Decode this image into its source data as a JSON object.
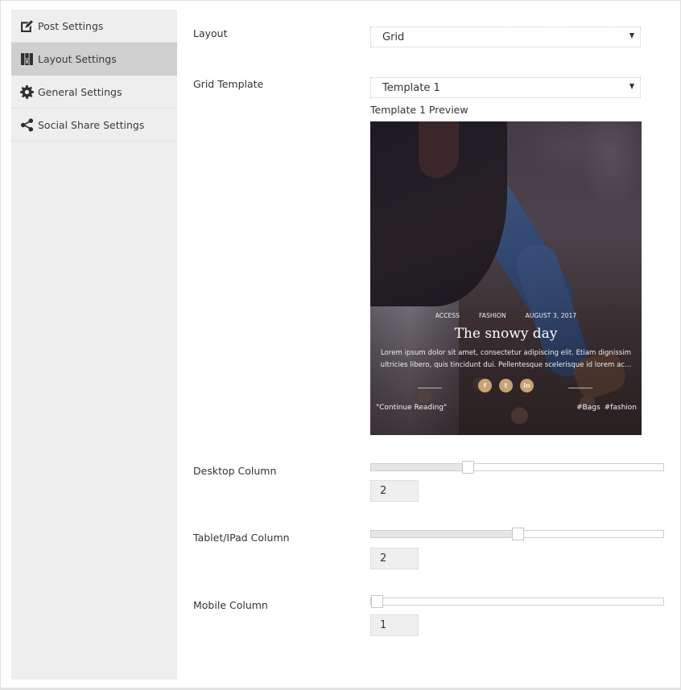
{
  "sidebar": {
    "items": [
      {
        "label": "Post Settings",
        "icon": "edit-icon",
        "active": false
      },
      {
        "label": "Layout Settings",
        "icon": "layout-icon",
        "active": true
      },
      {
        "label": "General Settings",
        "icon": "gear-icon",
        "active": false
      },
      {
        "label": "Social Share Settings",
        "icon": "share-icon",
        "active": false
      }
    ]
  },
  "form": {
    "layout": {
      "label": "Layout",
      "value": "Grid"
    },
    "grid_template": {
      "label": "Grid Template",
      "value": "Template 1",
      "preview_caption": "Template 1 Preview"
    },
    "desktop_column": {
      "label": "Desktop Column",
      "value": "2",
      "slider_fraction": 0.33
    },
    "tablet_column": {
      "label": "Tablet/IPad Column",
      "value": "2",
      "slider_fraction": 0.5
    },
    "mobile_column": {
      "label": "Mobile Column",
      "value": "1",
      "slider_fraction": 0.0
    }
  },
  "preview": {
    "meta": [
      "ACCESS",
      "FASHION",
      "AUGUST 3, 2017"
    ],
    "title": "The snowy day",
    "excerpt": "Lorem ipsum dolor sit amet, consectetur adipiscing elit. Etiam dignissim ultricies libero, quis tincidunt dui. Pellentesque scelerisque id lorem ac...",
    "socials": [
      {
        "name": "facebook",
        "glyph": "f"
      },
      {
        "name": "twitter",
        "glyph": "t"
      },
      {
        "name": "linkedin",
        "glyph": "in"
      }
    ],
    "continue_reading": "\"Continue Reading\"",
    "tags": [
      "#Bags",
      "#fashion"
    ],
    "social_color": "#c9a277"
  }
}
